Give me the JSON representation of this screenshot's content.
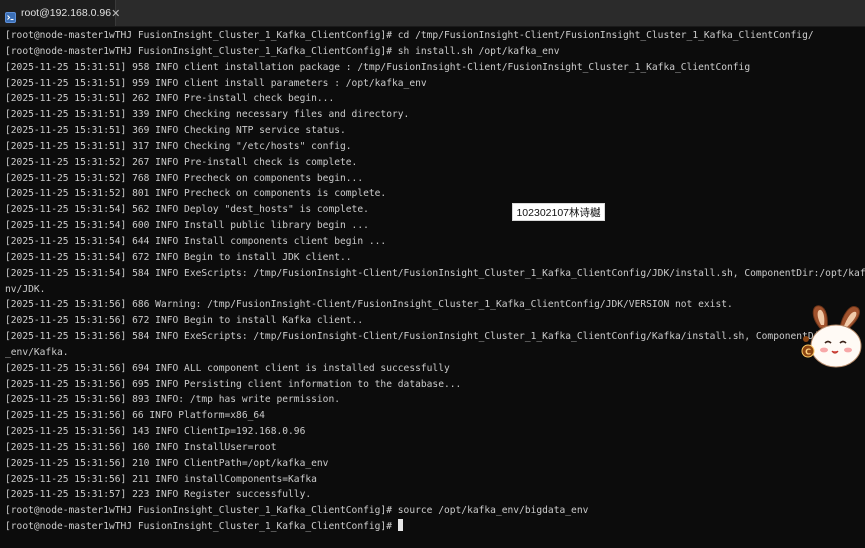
{
  "tab": {
    "title": "root@192.168.0.96",
    "icon": "terminal-icon"
  },
  "terminal": {
    "lines": [
      "[root@node-master1wTHJ FusionInsight_Cluster_1_Kafka_ClientConfig]# cd /tmp/FusionInsight-Client/FusionInsight_Cluster_1_Kafka_ClientConfig/",
      "[root@node-master1wTHJ FusionInsight_Cluster_1_Kafka_ClientConfig]# sh install.sh /opt/kafka_env",
      "[2025-11-25 15:31:51] 958 INFO client installation package : /tmp/FusionInsight-Client/FusionInsight_Cluster_1_Kafka_ClientConfig",
      "[2025-11-25 15:31:51] 959 INFO client install parameters : /opt/kafka_env",
      "[2025-11-25 15:31:51] 262 INFO Pre-install check begin...",
      "[2025-11-25 15:31:51] 339 INFO Checking necessary files and directory.",
      "[2025-11-25 15:31:51] 369 INFO Checking NTP service status.",
      "[2025-11-25 15:31:51] 317 INFO Checking \"/etc/hosts\" config.",
      "[2025-11-25 15:31:52] 267 INFO Pre-install check is complete.",
      "[2025-11-25 15:31:52] 768 INFO Precheck on components begin...",
      "[2025-11-25 15:31:52] 801 INFO Precheck on components is complete.",
      "[2025-11-25 15:31:54] 562 INFO Deploy \"dest_hosts\" is complete.",
      "[2025-11-25 15:31:54] 600 INFO Install public library begin ...",
      "[2025-11-25 15:31:54] 644 INFO Install components client begin ...",
      "[2025-11-25 15:31:54] 672 INFO Begin to install JDK client..",
      "[2025-11-25 15:31:54] 584 INFO ExeScripts: /tmp/FusionInsight-Client/FusionInsight_Cluster_1_Kafka_ClientConfig/JDK/install.sh, ComponentDir:/opt/kafka_e",
      "nv/JDK.",
      "[2025-11-25 15:31:56] 686 Warning: /tmp/FusionInsight-Client/FusionInsight_Cluster_1_Kafka_ClientConfig/JDK/VERSION not exist.",
      "[2025-11-25 15:31:56] 672 INFO Begin to install Kafka client..",
      "[2025-11-25 15:31:56] 584 INFO ExeScripts: /tmp/FusionInsight-Client/FusionInsight_Cluster_1_Kafka_ClientConfig/Kafka/install.sh, ComponentDir:/",
      "_env/Kafka.",
      "[2025-11-25 15:31:56] 694 INFO ALL component client is installed successfully",
      "[2025-11-25 15:31:56] 695 INFO Persisting client information to the database...",
      "[2025-11-25 15:31:56] 893 INFO: /tmp has write permission.",
      "[2025-11-25 15:31:56] 66 INFO Platform=x86_64",
      "[2025-11-25 15:31:56] 143 INFO ClientIp=192.168.0.96",
      "[2025-11-25 15:31:56] 160 INFO InstallUser=root",
      "[2025-11-25 15:31:56] 210 INFO ClientPath=/opt/kafka_env",
      "[2025-11-25 15:31:56] 211 INFO installComponents=Kafka",
      "[2025-11-25 15:31:57] 223 INFO Register successfully.",
      "[root@node-master1wTHJ FusionInsight_Cluster_1_Kafka_ClientConfig]# source /opt/kafka_env/bigdata_env"
    ],
    "prompt": "[root@node-master1wTHJ FusionInsight_Cluster_1_Kafka_ClientConfig]# "
  },
  "watermark": {
    "text": "102302107林诗樾"
  },
  "overlay": {
    "mascot": "bunny-mascot-sticker",
    "mascot_badge": "C"
  },
  "colors": {
    "background": "#0c0c0c",
    "text": "#cccccc",
    "tab_bar": "#2b2b2b"
  }
}
